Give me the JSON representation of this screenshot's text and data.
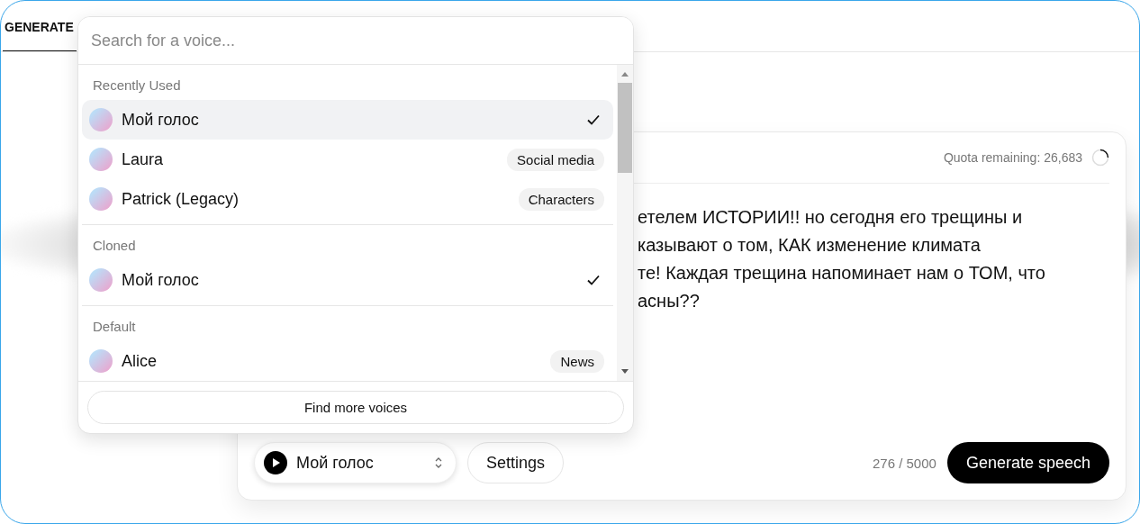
{
  "tabs": [
    {
      "label": "GENERATE",
      "selected": true
    }
  ],
  "voice_picker": {
    "search": {
      "placeholder": "Search for a voice..."
    },
    "groups": [
      {
        "title": "Recently Used",
        "voices": [
          {
            "name": "Мой голос",
            "checked": true,
            "selected": true
          },
          {
            "name": "Laura",
            "tag": "Social media",
            "checked": false,
            "selected": false
          },
          {
            "name": "Patrick (Legacy)",
            "tag": "Characters",
            "checked": false,
            "selected": false
          }
        ]
      },
      {
        "title": "Cloned",
        "voices": [
          {
            "name": "Мой голос",
            "checked": true,
            "selected": false
          }
        ]
      },
      {
        "title": "Default",
        "voices": [
          {
            "name": "Alice",
            "tag": "News",
            "checked": false,
            "selected": false
          }
        ]
      }
    ],
    "footer_button": "Find more voices"
  },
  "editor": {
    "quota": "Quota remaining: 26,683",
    "text_lines": [
      "етелем ИСТОРИИ!! но сегодня его трещины и",
      "казывают о том, КАК изменение климата",
      "те! Каждая трещина напоминает нам о ТОМ, что",
      "асны??"
    ],
    "voice_select": "Мой голос",
    "settings_button": "Settings",
    "char_count": "276 / 5000",
    "generate_button": "Generate speech"
  }
}
